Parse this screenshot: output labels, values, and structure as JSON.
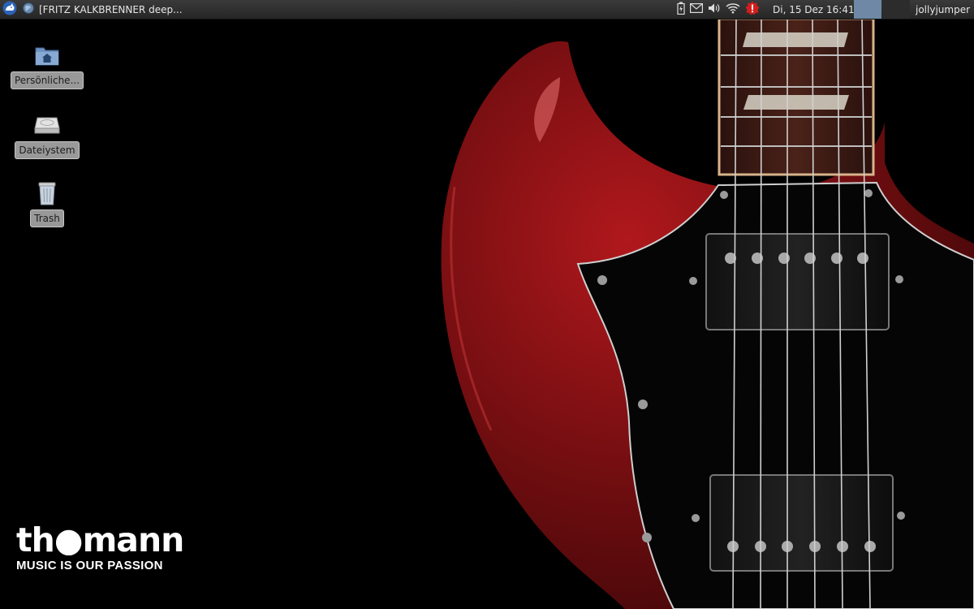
{
  "panel": {
    "task": {
      "title": "[FRITZ KALKBRENNER deep..."
    },
    "clock": {
      "text": "Di, 15 Dez  16:41"
    },
    "user": {
      "name": "jollyjumper"
    },
    "tray_icons": [
      "battery-icon",
      "mail-icon",
      "volume-icon",
      "wifi-icon",
      "update-alert-icon"
    ]
  },
  "desktop_icons": [
    {
      "label": "Persönliche...",
      "icon": "home-folder-icon"
    },
    {
      "label": "Dateiystem",
      "icon": "drive-icon"
    },
    {
      "label": "Trash",
      "icon": "trash-icon"
    }
  ],
  "wallpaper": {
    "brand": "th●mann",
    "tagline": "MUSIC IS OUR PASSION",
    "colors": {
      "guitar_body": "#7a0f12",
      "pickguard": "#050505",
      "fretboard": "#3a1a14"
    }
  }
}
